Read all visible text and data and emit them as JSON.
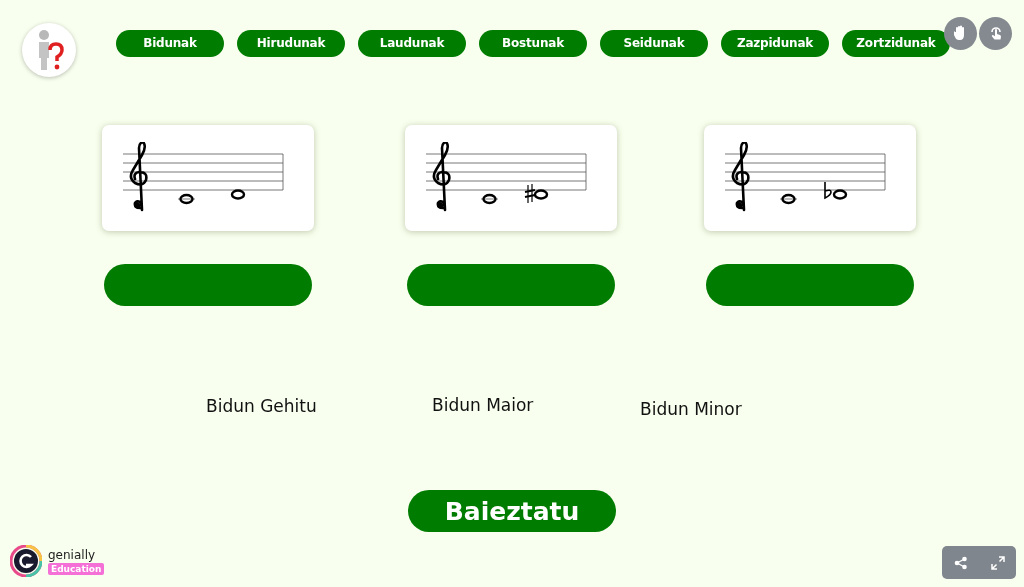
{
  "nav": [
    {
      "label": "Bidunak"
    },
    {
      "label": "Hirudunak"
    },
    {
      "label": "Laudunak"
    },
    {
      "label": "Bostunak"
    },
    {
      "label": "Seidunak"
    },
    {
      "label": "Zazpidunak"
    },
    {
      "label": "Zortzidunak"
    }
  ],
  "cards": [
    {
      "sharp": false,
      "flat": false
    },
    {
      "sharp": true,
      "flat": false
    },
    {
      "sharp": false,
      "flat": true
    }
  ],
  "answers": [
    "Bidun Gehitu",
    "Bidun Maior",
    "Bidun Minor"
  ],
  "confirm_button": "Baieztatu",
  "brand": {
    "name": "genially",
    "badge": "Education"
  }
}
